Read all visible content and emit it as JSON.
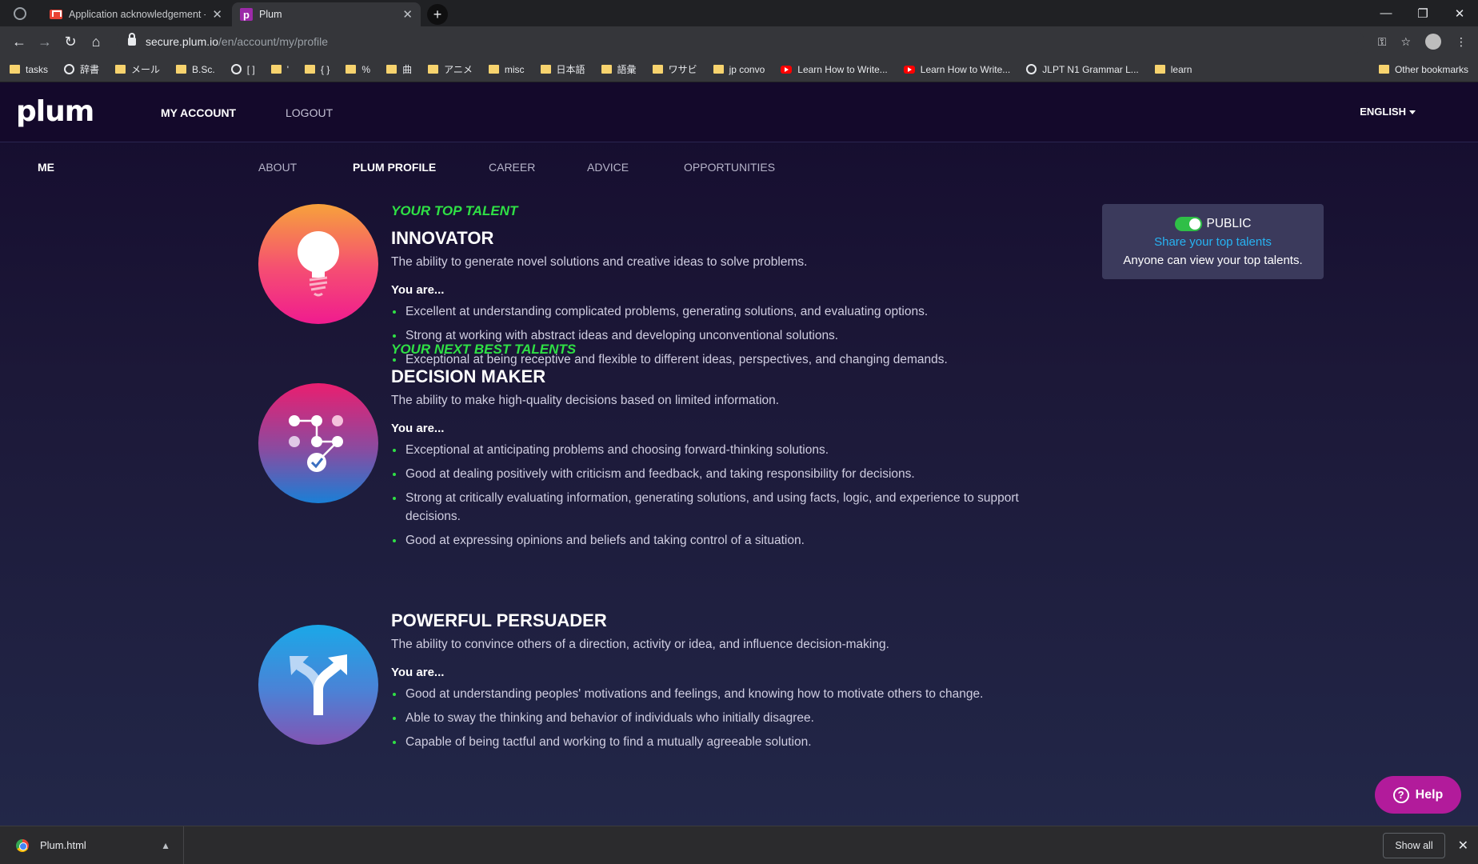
{
  "browser": {
    "tabs": [
      {
        "title": "Application acknowledgement - j",
        "active": false
      },
      {
        "title": "Plum",
        "active": true
      }
    ],
    "new_tab": "+",
    "window_controls": [
      "—",
      "❐",
      "✕"
    ],
    "url_host": "secure.plum.io",
    "url_path": "/en/account/my/profile",
    "bookmarks": [
      {
        "label": "tasks",
        "icon": "folder-icon"
      },
      {
        "label": "辞書",
        "icon": "globe-icon"
      },
      {
        "label": "メール",
        "icon": "folder-icon"
      },
      {
        "label": "B.Sc.",
        "icon": "folder-icon"
      },
      {
        "label": "[ ]",
        "icon": "globe-icon"
      },
      {
        "label": "'",
        "icon": "folder-icon"
      },
      {
        "label": "{ }",
        "icon": "folder-icon"
      },
      {
        "label": "%",
        "icon": "folder-icon"
      },
      {
        "label": "曲",
        "icon": "folder-icon"
      },
      {
        "label": "アニメ",
        "icon": "folder-icon"
      },
      {
        "label": "misc",
        "icon": "folder-icon"
      },
      {
        "label": "日本語",
        "icon": "folder-icon"
      },
      {
        "label": "語彙",
        "icon": "folder-icon"
      },
      {
        "label": "ワサビ",
        "icon": "folder-icon"
      },
      {
        "label": "jp convo",
        "icon": "folder-icon"
      },
      {
        "label": "Learn How to Write...",
        "icon": "youtube-icon"
      },
      {
        "label": "Learn How to Write...",
        "icon": "youtube-icon"
      },
      {
        "label": "JLPT N1 Grammar L...",
        "icon": "globe-icon"
      },
      {
        "label": "learn",
        "icon": "folder-icon"
      }
    ],
    "other_bookmarks": "Other bookmarks"
  },
  "header": {
    "logo": "plum",
    "nav": [
      "MY ACCOUNT",
      "LOGOUT"
    ],
    "language": "ENGLISH"
  },
  "subnav": {
    "me": "ME",
    "items": [
      "ABOUT",
      "PLUM PROFILE",
      "CAREER",
      "ADVICE",
      "OPPORTUNITIES"
    ],
    "active": "PLUM PROFILE"
  },
  "talents": {
    "top_label": "YOUR TOP TALENT",
    "next_label": "YOUR NEXT BEST TALENTS",
    "you_are": "You are...",
    "items": [
      {
        "title": "INNOVATOR",
        "icon": "lightbulb-icon",
        "description": "The ability to generate novel solutions and creative ideas to solve problems.",
        "bullets": [
          "Excellent at understanding complicated problems, generating solutions, and evaluating options.",
          "Strong at working with abstract ideas and developing unconventional solutions.",
          "Exceptional at being receptive and flexible to different ideas, perspectives, and changing demands."
        ]
      },
      {
        "title": "DECISION MAKER",
        "icon": "decision-tree-icon",
        "description": "The ability to make high-quality decisions based on limited information.",
        "bullets": [
          "Exceptional at anticipating problems and choosing forward-thinking solutions.",
          "Good at dealing positively with criticism and feedback, and taking responsibility for decisions.",
          "Strong at critically evaluating information, generating solutions, and using facts, logic, and experience to support decisions.",
          "Good at expressing opinions and beliefs and taking control of a situation."
        ]
      },
      {
        "title": "POWERFUL PERSUADER",
        "icon": "split-arrows-icon",
        "description": "The ability to convince others of a direction, activity or idea, and influence decision-making.",
        "bullets": [
          "Good at understanding peoples' motivations and feelings, and knowing how to motivate others to change.",
          "Able to sway the thinking and behavior of individuals who initially disagree.",
          "Capable of being tactful and working to find a mutually agreeable solution."
        ]
      }
    ]
  },
  "public_card": {
    "toggle_label": "PUBLIC",
    "toggle_on": true,
    "share_link": "Share your top talents",
    "note": "Anyone can view your top talents."
  },
  "help": {
    "label": "Help"
  },
  "download_shelf": {
    "file": "Plum.html",
    "show_all": "Show all"
  },
  "colors": {
    "accent_green": "#2fe045",
    "link_blue": "#27b3f2",
    "help_magenta": "#b21b9b"
  }
}
